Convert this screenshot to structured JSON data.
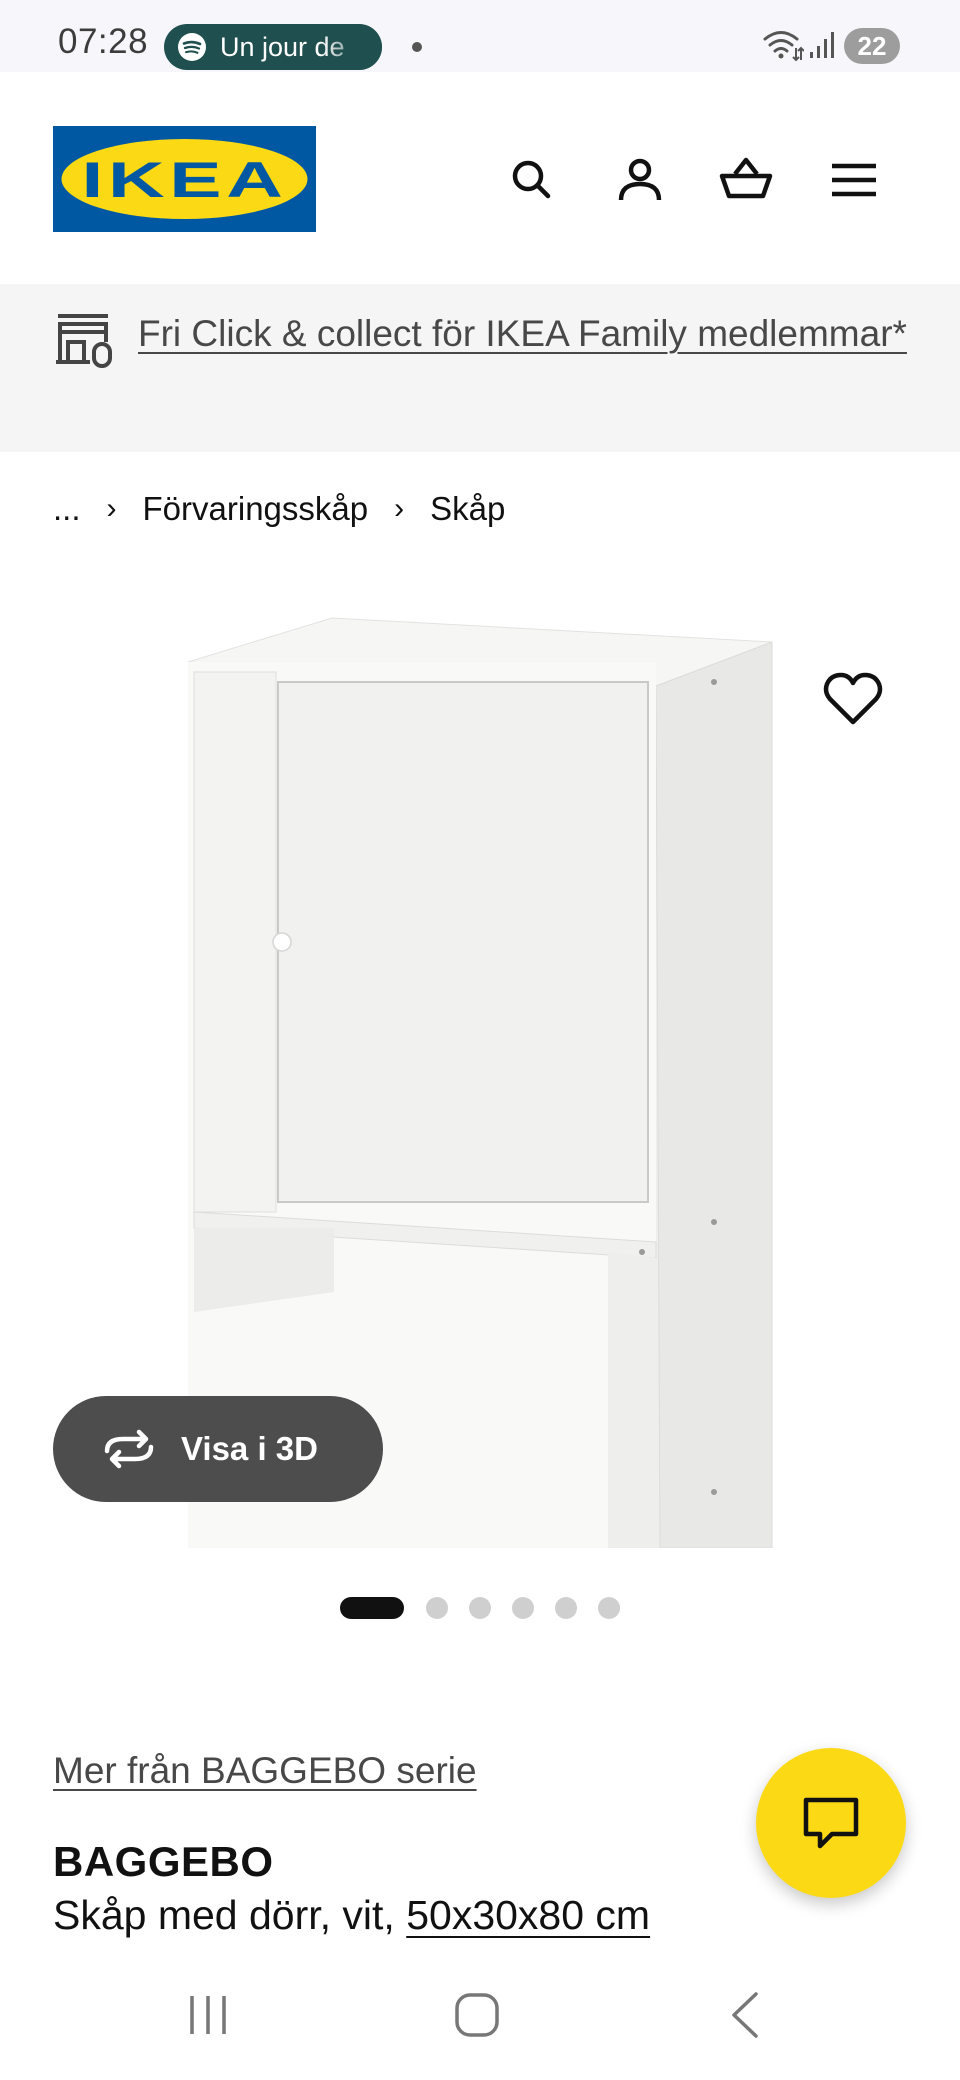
{
  "status_bar": {
    "time": "07:28",
    "media_text": "Un jour de",
    "battery": "22"
  },
  "header": {
    "logo_text": "IKEA",
    "icons": [
      "search-icon",
      "account-icon",
      "basket-icon",
      "menu-icon"
    ]
  },
  "promo": {
    "text": "Fri Click & collect för IKEA Family medlemmar*"
  },
  "breadcrumb": {
    "ellipsis": "...",
    "separator": "›",
    "items": [
      "Förvaringsskåp",
      "Skåp"
    ]
  },
  "gallery": {
    "view_3d_label": "Visa i 3D",
    "total_images": 6,
    "active_image": 1
  },
  "product": {
    "series_link": "Mer från BAGGEBO serie",
    "name": "BAGGEBO",
    "description_prefix": "Skåp med dörr, vit, ",
    "size": "50x30x80 cm"
  },
  "colors": {
    "ikea_blue": "#0058a3",
    "ikea_yellow": "#fbd914",
    "promo_bg": "#f5f5f5",
    "pill_bg": "#4d4d4d"
  }
}
